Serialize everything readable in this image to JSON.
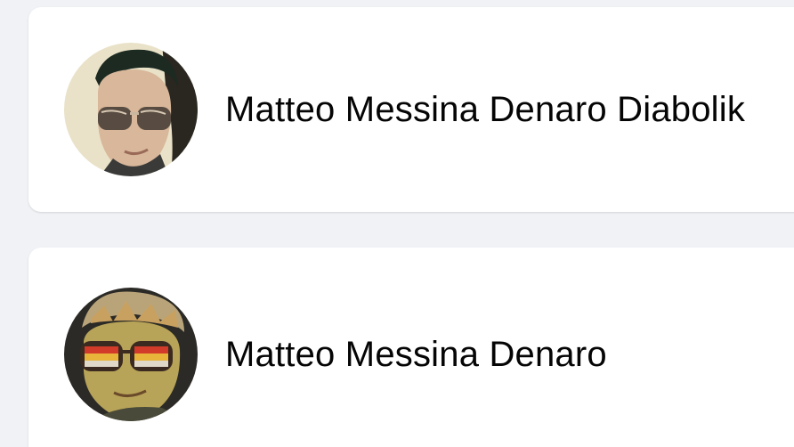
{
  "results": [
    {
      "name": "Matteo Messina Denaro Diabolik",
      "avatar_icon": "profile-photo-sunglasses-man"
    },
    {
      "name": "Matteo Messina Denaro",
      "avatar_icon": "profile-painting-sunglasses-man"
    }
  ],
  "colors": {
    "page_background": "#f0f2f5",
    "card_background": "#ffffff",
    "name_text": "#050505"
  }
}
